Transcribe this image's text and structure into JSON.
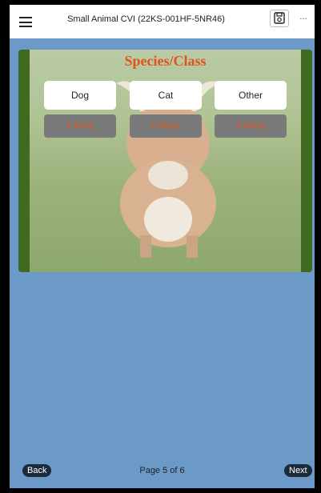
{
  "header": {
    "title": "Small Animal CVI (22KS-001HF-5NR46)",
    "more_label": "..."
  },
  "card": {
    "heading": "Species/Class",
    "options": [
      {
        "label": "Dog",
        "entry": "1 Entry"
      },
      {
        "label": "Cat",
        "entry": "0 Entry"
      },
      {
        "label": "Other",
        "entry": "0 Entry"
      }
    ]
  },
  "footer": {
    "back_label": "Back",
    "page_info": "Page 5 of 6",
    "next_label": "Next"
  },
  "colors": {
    "accent": "#e0541a",
    "background": "#6b9ac9",
    "entry_bg": "#7a7a7a"
  }
}
